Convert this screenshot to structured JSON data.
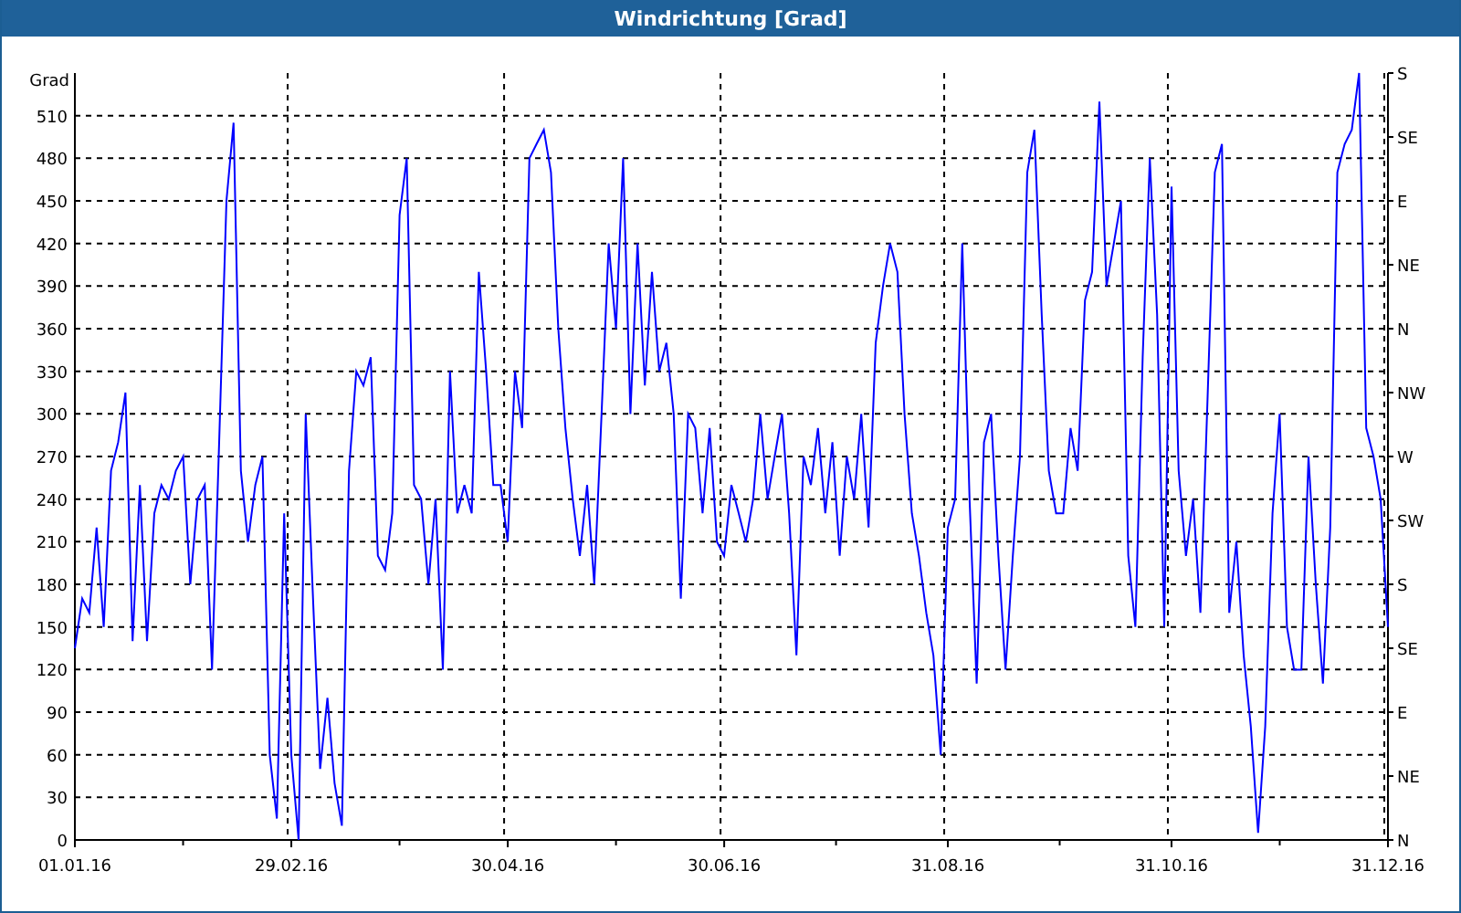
{
  "window": {
    "title": "Windrichtung [Grad]"
  },
  "chart": {
    "right_axis_labels": [
      "S",
      "SE",
      "E",
      "NE",
      "N",
      "NW",
      "W",
      "SW",
      "S",
      "SE",
      "E",
      "NE",
      "N"
    ],
    "chart_data": {
      "type": "line",
      "grid": true,
      "ylabel": "Grad",
      "ylim": [
        0,
        540
      ],
      "yticks": [
        0,
        30,
        60,
        90,
        120,
        150,
        180,
        210,
        240,
        270,
        300,
        330,
        360,
        390,
        420,
        450,
        480,
        510
      ],
      "categories": [
        "01.01.16",
        null,
        null,
        null,
        null,
        null,
        null,
        null,
        null,
        null,
        null,
        null,
        null,
        null,
        null,
        null,
        null,
        null,
        null,
        null,
        null,
        null,
        null,
        null,
        null,
        null,
        null,
        null,
        null,
        null,
        "29.02.16",
        null,
        null,
        null,
        null,
        null,
        null,
        null,
        null,
        null,
        null,
        null,
        null,
        null,
        null,
        null,
        null,
        null,
        null,
        null,
        null,
        null,
        null,
        null,
        null,
        null,
        null,
        null,
        null,
        null,
        "30.04.16",
        null,
        null,
        null,
        null,
        null,
        null,
        null,
        null,
        null,
        null,
        null,
        null,
        null,
        null,
        null,
        null,
        null,
        null,
        null,
        null,
        null,
        null,
        null,
        null,
        null,
        null,
        null,
        null,
        null,
        "30.06.16",
        null,
        null,
        null,
        null,
        null,
        null,
        null,
        null,
        null,
        null,
        null,
        null,
        null,
        null,
        null,
        null,
        null,
        null,
        null,
        null,
        null,
        null,
        null,
        null,
        null,
        null,
        null,
        null,
        null,
        null,
        "31.08.16",
        null,
        null,
        null,
        null,
        null,
        null,
        null,
        null,
        null,
        null,
        null,
        null,
        null,
        null,
        null,
        null,
        null,
        null,
        null,
        null,
        null,
        null,
        null,
        null,
        null,
        null,
        null,
        null,
        null,
        null,
        "31.10.16",
        null,
        null,
        null,
        null,
        null,
        null,
        null,
        null,
        null,
        null,
        null,
        null,
        null,
        null,
        null,
        null,
        null,
        null,
        null,
        null,
        null,
        null,
        null,
        null,
        null,
        null,
        null,
        null,
        null,
        "31.12.16"
      ],
      "series": [
        {
          "color": "#0000ff",
          "values": [
            135,
            170,
            160,
            220,
            150,
            260,
            280,
            315,
            140,
            250,
            140,
            230,
            250,
            240,
            260,
            270,
            180,
            240,
            250,
            120,
            280,
            450,
            505,
            260,
            210,
            250,
            270,
            60,
            15,
            230,
            60,
            0,
            300,
            170,
            50,
            100,
            40,
            10,
            260,
            330,
            320,
            340,
            200,
            190,
            230,
            440,
            480,
            250,
            240,
            180,
            240,
            120,
            330,
            230,
            250,
            230,
            400,
            330,
            250,
            250,
            210,
            330,
            290,
            480,
            490,
            500,
            470,
            360,
            290,
            240,
            200,
            250,
            180,
            300,
            420,
            360,
            480,
            300,
            420,
            320,
            400,
            330,
            350,
            300,
            170,
            300,
            290,
            230,
            290,
            210,
            200,
            250,
            230,
            210,
            240,
            300,
            240,
            270,
            300,
            230,
            130,
            270,
            250,
            290,
            230,
            280,
            200,
            270,
            240,
            300,
            220,
            350,
            390,
            420,
            400,
            300,
            230,
            200,
            160,
            130,
            60,
            220,
            240,
            420,
            240,
            110,
            280,
            300,
            200,
            120,
            200,
            270,
            470,
            500,
            370,
            260,
            230,
            230,
            290,
            260,
            380,
            400,
            520,
            390,
            420,
            450,
            200,
            150,
            340,
            480,
            370,
            150,
            460,
            260,
            200,
            240,
            160,
            310,
            470,
            490,
            160,
            210,
            130,
            80,
            5,
            80,
            230,
            300,
            150,
            120,
            120,
            270,
            180,
            110,
            220,
            470,
            490,
            500,
            540,
            290,
            270,
            240,
            150
          ]
        }
      ]
    }
  }
}
